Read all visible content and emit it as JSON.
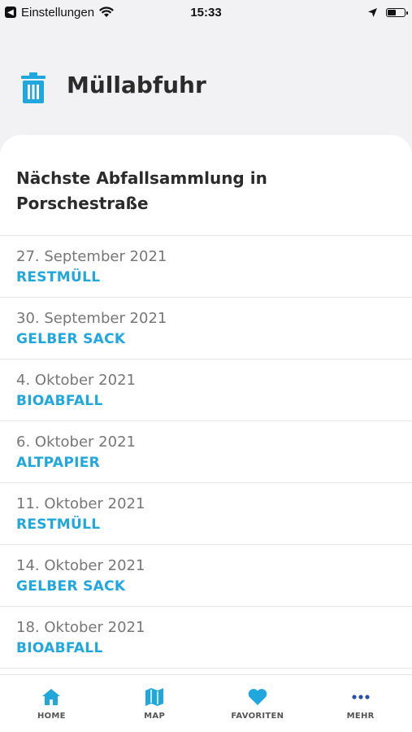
{
  "status_bar": {
    "back_label": "Einstellungen",
    "time": "15:33",
    "battery_level": 0.55
  },
  "header": {
    "title": "Müllabfuhr",
    "icon": "trash-icon",
    "accent": "#20a7dd"
  },
  "card": {
    "title": "Nächste Abfallsammlung in Porschestraße",
    "items": [
      {
        "date": "27. September 2021",
        "type": "RESTMÜLL"
      },
      {
        "date": "30. September 2021",
        "type": "GELBER SACK"
      },
      {
        "date": "4. Oktober 2021",
        "type": "BIOABFALL"
      },
      {
        "date": "6. Oktober 2021",
        "type": "ALTPAPIER"
      },
      {
        "date": "11. Oktober 2021",
        "type": "RESTMÜLL"
      },
      {
        "date": "14. Oktober 2021",
        "type": "GELBER SACK"
      },
      {
        "date": "18. Oktober 2021",
        "type": "BIOABFALL"
      }
    ]
  },
  "tabbar": {
    "tabs": [
      {
        "label": "HOME",
        "icon": "home-icon"
      },
      {
        "label": "MAP",
        "icon": "map-icon"
      },
      {
        "label": "FAVORITEN",
        "icon": "heart-icon"
      },
      {
        "label": "MEHR",
        "icon": "more-icon"
      }
    ]
  }
}
